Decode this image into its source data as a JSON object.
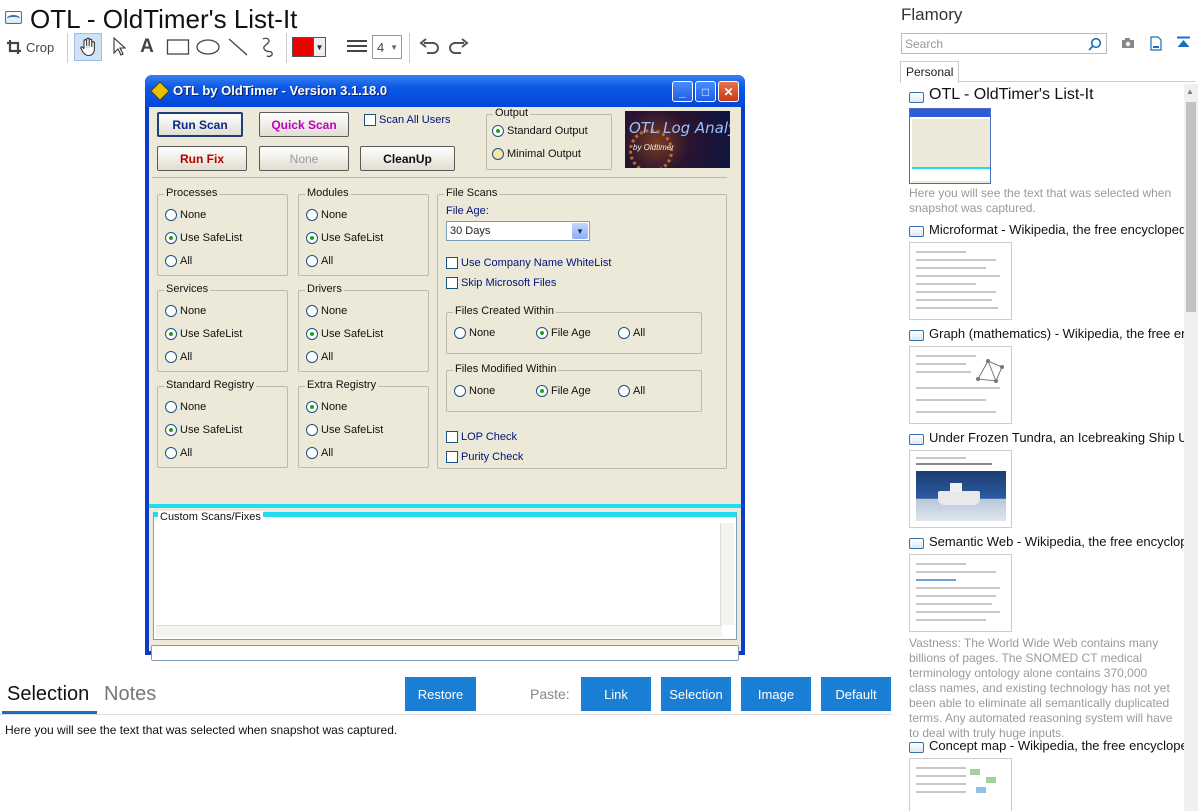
{
  "app": {
    "title": "OTL - OldTimer's List-It"
  },
  "toolbar": {
    "crop_label": "Crop",
    "line_width": "4"
  },
  "snapshot": {
    "window_title": "OTL by OldTimer - Version 3.1.18.0",
    "buttons": {
      "run_scan": "Run Scan",
      "quick_scan": "Quick Scan",
      "run_fix": "Run Fix",
      "none": "None",
      "cleanup": "CleanUp"
    },
    "scan_all_users": "Scan All Users",
    "output": {
      "label": "Output",
      "standard": "Standard Output",
      "minimal": "Minimal Output"
    },
    "logo": {
      "title": "OTL Log Analysis",
      "subtitle": "by Oldtimer"
    },
    "groups": {
      "processes": "Processes",
      "modules": "Modules",
      "services": "Services",
      "drivers": "Drivers",
      "standard_registry": "Standard Registry",
      "extra_registry": "Extra Registry"
    },
    "options": {
      "none": "None",
      "safelist": "Use SafeList",
      "all": "All"
    },
    "file_scans": {
      "label": "File Scans",
      "file_age_label": "File Age:",
      "file_age_value": "30 Days",
      "whitelist": "Use Company Name WhiteList",
      "skip_ms": "Skip Microsoft Files",
      "created_within": "Files Created Within",
      "modified_within": "Files Modified Within",
      "none": "None",
      "file_age": "File Age",
      "all": "All",
      "lop_check": "LOP Check",
      "purity_check": "Purity Check"
    },
    "custom_scans_label": "Custom Scans/Fixes"
  },
  "bottom": {
    "tabs": [
      "Selection",
      "Notes"
    ],
    "restore": "Restore",
    "paste_label": "Paste:",
    "paste_buttons": [
      "Link",
      "Selection",
      "Image",
      "Default"
    ],
    "selection_text": "Here you will see the text that was selected when snapshot was captured."
  },
  "right_pane": {
    "title": "Flamory",
    "search_placeholder": "Search",
    "tab": "Personal",
    "entries": [
      {
        "title": "OTL - OldTimer's List-It",
        "desc": "Here you will see the text that was selected when snapshot was captured."
      },
      {
        "title": "Microformat - Wikipedia, the free encyclopedia"
      },
      {
        "title": "Graph (mathematics) - Wikipedia, the free ency"
      },
      {
        "title": "Under Frozen Tundra, an Icebreaking Ship Unco"
      },
      {
        "title": "Semantic Web - Wikipedia, the free encycloped",
        "desc": "Vastness: The World Wide Web contains many billions of pages. The SNOMED CT medical terminology ontology alone contains 370,000 class names, and existing technology has not yet been able to eliminate all semantically duplicated terms. Any automated reasoning system will have to deal with truly huge inputs."
      },
      {
        "title": "Concept map - Wikipedia, the free encyclopedi"
      }
    ]
  },
  "colors": {
    "accent": "#1a7fd4",
    "xp_title": "#0a58e6",
    "pen_color": "#ee0000"
  }
}
